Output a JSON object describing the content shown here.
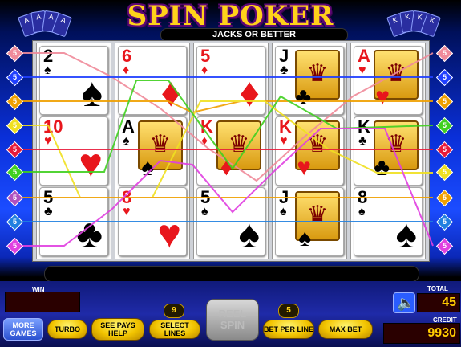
{
  "game": {
    "title": "SPIN POKER",
    "subtitle": "JACKS OR BETTER"
  },
  "reels": [
    [
      {
        "rank": "2",
        "suit": "♠",
        "color": "black",
        "face": false
      },
      {
        "rank": "10",
        "suit": "♥",
        "color": "red",
        "face": false
      },
      {
        "rank": "5",
        "suit": "♣",
        "color": "black",
        "face": false
      }
    ],
    [
      {
        "rank": "6",
        "suit": "♦",
        "color": "red",
        "face": false
      },
      {
        "rank": "A",
        "suit": "♠",
        "color": "black",
        "face": true
      },
      {
        "rank": "8",
        "suit": "♥",
        "color": "red",
        "face": false
      }
    ],
    [
      {
        "rank": "5",
        "suit": "♦",
        "color": "red",
        "face": false
      },
      {
        "rank": "K",
        "suit": "♦",
        "color": "red",
        "face": true
      },
      {
        "rank": "5",
        "suit": "♠",
        "color": "black",
        "face": false
      }
    ],
    [
      {
        "rank": "J",
        "suit": "♣",
        "color": "black",
        "face": true
      },
      {
        "rank": "K",
        "suit": "♥",
        "color": "red",
        "face": true
      },
      {
        "rank": "J",
        "suit": "♠",
        "color": "black",
        "face": true
      }
    ],
    [
      {
        "rank": "A",
        "suit": "♥",
        "color": "red",
        "face": true
      },
      {
        "rank": "K",
        "suit": "♣",
        "color": "black",
        "face": true
      },
      {
        "rank": "8",
        "suit": "♠",
        "color": "black",
        "face": false
      }
    ]
  ],
  "paylines": {
    "left": [
      {
        "label": "5",
        "color": "#f08a9a"
      },
      {
        "label": "5",
        "color": "#2040ff"
      },
      {
        "label": "5",
        "color": "#f0a000"
      },
      {
        "label": "5",
        "color": "#f0e020"
      },
      {
        "label": "5",
        "color": "#e81a3a"
      },
      {
        "label": "5",
        "color": "#40d020"
      },
      {
        "label": "5",
        "color": "#b050c0"
      },
      {
        "label": "5",
        "color": "#2080e0"
      },
      {
        "label": "5",
        "color": "#e040e0"
      }
    ],
    "right": [
      {
        "label": "5",
        "color": "#f08a9a"
      },
      {
        "label": "5",
        "color": "#2040ff"
      },
      {
        "label": "5",
        "color": "#f0a000"
      },
      {
        "label": "5",
        "color": "#40d020"
      },
      {
        "label": "5",
        "color": "#e81a3a"
      },
      {
        "label": "5",
        "color": "#f0e020"
      },
      {
        "label": "5",
        "color": "#f0a000"
      },
      {
        "label": "5",
        "color": "#2080e0"
      },
      {
        "label": "5",
        "color": "#e040e0"
      }
    ]
  },
  "labels": {
    "win": "WIN",
    "total_bet": "TOTAL BET",
    "credit": "CREDIT"
  },
  "values": {
    "win": "",
    "total_bet": "45",
    "credit": "9930",
    "lines": "9",
    "bet_per_line": "5"
  },
  "buttons": {
    "more_games": "MORE GAMES",
    "turbo": "TURBO",
    "see_pays": "SEE PAYS HELP",
    "select_lines": "SELECT LINES",
    "spin": "REEL SPIN",
    "bet_per_line": "BET PER LINE",
    "max_bet": "MAX BET"
  }
}
